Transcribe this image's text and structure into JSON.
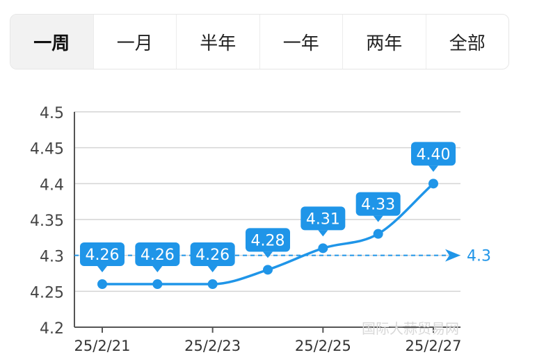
{
  "tabs": [
    {
      "label": "一周",
      "active": true
    },
    {
      "label": "一月",
      "active": false
    },
    {
      "label": "半年",
      "active": false
    },
    {
      "label": "一年",
      "active": false
    },
    {
      "label": "两年",
      "active": false
    },
    {
      "label": "全部",
      "active": false
    }
  ],
  "chart_data": {
    "type": "line",
    "x": [
      "25/2/21",
      "25/2/22",
      "25/2/23",
      "25/2/24",
      "25/2/25",
      "25/2/26",
      "25/2/27"
    ],
    "values": [
      4.26,
      4.26,
      4.26,
      4.28,
      4.31,
      4.33,
      4.4
    ],
    "data_labels": [
      "4.26",
      "4.26",
      "4.26",
      "4.28",
      "4.31",
      "4.33",
      "4.40"
    ],
    "x_tick_labels": [
      "25/2/21",
      "25/2/23",
      "25/2/25",
      "25/2/27"
    ],
    "y_ticks": [
      4.2,
      4.25,
      4.3,
      4.35,
      4.4,
      4.45,
      4.5
    ],
    "y_tick_labels": [
      "4.2",
      "4.25",
      "4.3",
      "4.35",
      "4.4",
      "4.45",
      "4.5"
    ],
    "ylim": [
      4.2,
      4.5
    ],
    "reference_line": {
      "value": 4.3,
      "label": "4.3"
    },
    "grid": true,
    "colors": {
      "line": "#1f95e8",
      "label_bg": "#1f95e8",
      "grid": "#d4d4d4",
      "axis": "#555555"
    }
  },
  "watermark": "国际大蒜贸易网"
}
